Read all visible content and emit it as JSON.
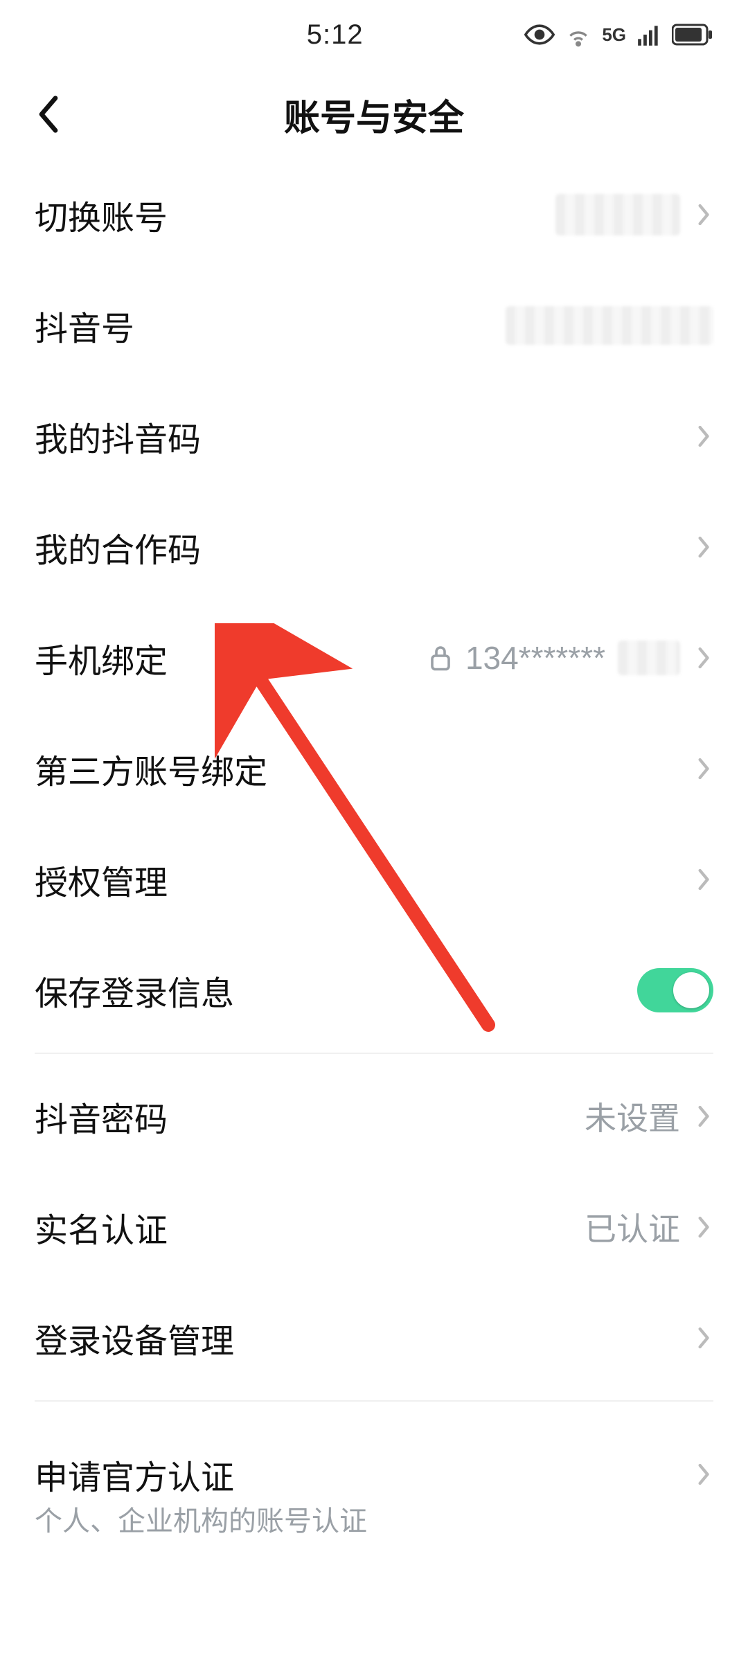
{
  "status": {
    "time": "5:12",
    "network_label": "5G"
  },
  "header": {
    "title": "账号与安全"
  },
  "rows": {
    "switch_account": {
      "label": "切换账号",
      "value": ""
    },
    "douyin_id": {
      "label": "抖音号",
      "value": ""
    },
    "my_douyin_code": {
      "label": "我的抖音码"
    },
    "my_partner_code": {
      "label": "我的合作码"
    },
    "phone_binding": {
      "label": "手机绑定",
      "value": "134*******"
    },
    "third_party": {
      "label": "第三方账号绑定"
    },
    "auth_mgmt": {
      "label": "授权管理"
    },
    "save_login": {
      "label": "保存登录信息",
      "on": true
    },
    "password": {
      "label": "抖音密码",
      "value": "未设置"
    },
    "real_name": {
      "label": "实名认证",
      "value": "已认证"
    },
    "login_devices": {
      "label": "登录设备管理"
    },
    "official_verify": {
      "label": "申请官方认证",
      "subtitle": "个人、企业机构的账号认证"
    }
  }
}
